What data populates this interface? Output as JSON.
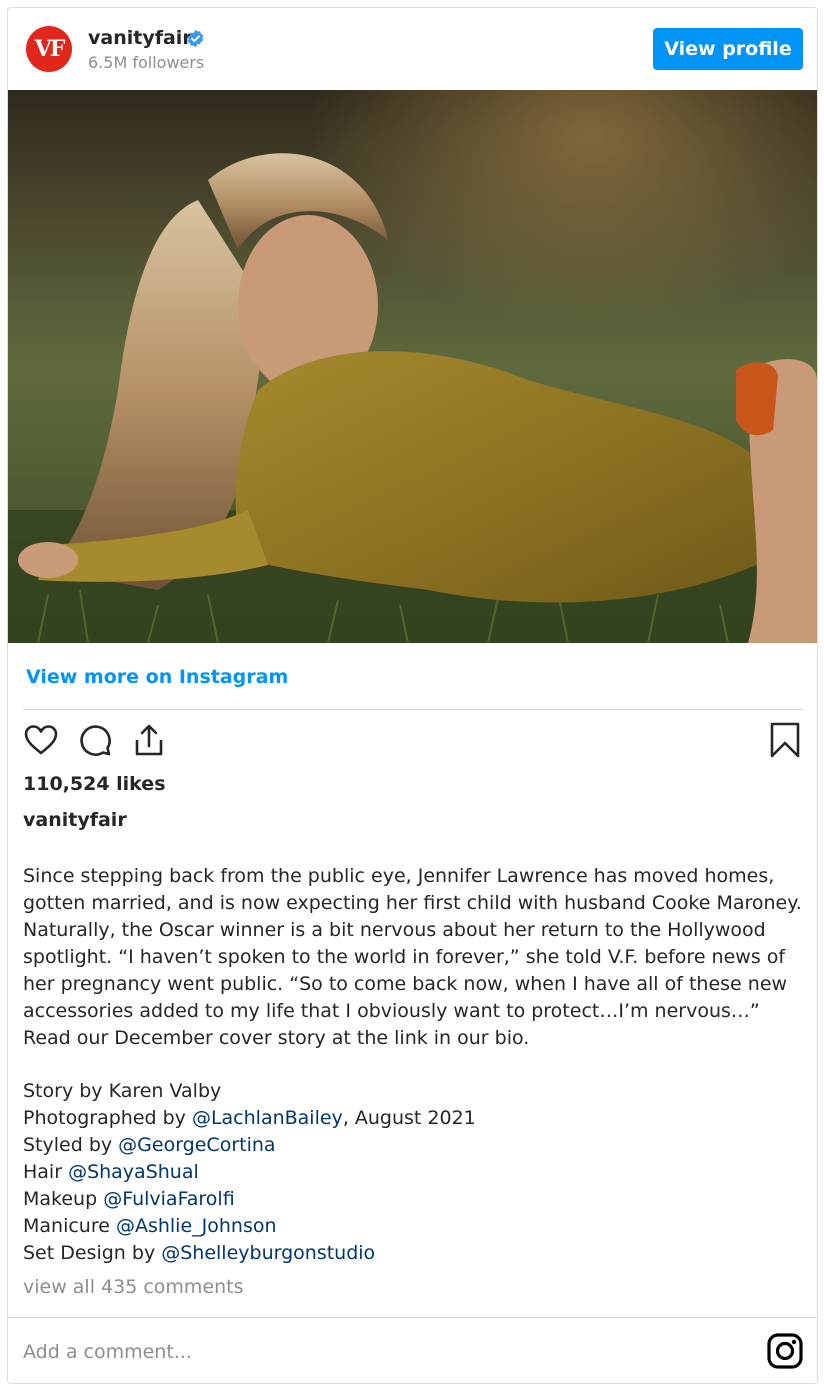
{
  "header": {
    "avatar_text": "VF",
    "username": "vanityfair",
    "verified_icon": "verified-badge-icon",
    "followers": "6.5M followers",
    "view_profile_label": "View profile"
  },
  "post": {
    "view_more_label": "View more on Instagram",
    "likes": "110,524 likes",
    "caption_username": "vanityfair",
    "caption_text": "Since stepping back from the public eye, Jennifer Lawrence has moved homes, gotten married, and is now expecting her first child with husband Cooke Maroney. Naturally, the Oscar winner is a bit nervous about her return to the Hollywood spotlight. “I haven’t spoken to the world in forever,” she told V.F. before news of her pregnancy went public. “So to come back now, when I have all of these new accessories added to my life that I obviously want to protect…I’m nervous…” Read our December cover story at the link in our bio.",
    "credits": {
      "story": "Story by Karen Valby",
      "photo_prefix": "Photographed by ",
      "photo_mention": "@LachlanBailey",
      "photo_suffix": ", August 2021",
      "styled_prefix": "Styled by ",
      "styled_mention": "@GeorgeCortina",
      "hair_prefix": "Hair ",
      "hair_mention": "@ShayaShual",
      "makeup_prefix": "Makeup ",
      "makeup_mention": "@FulviaFarolfi",
      "manicure_prefix": "Manicure ",
      "manicure_mention": "@Ashlie_Johnson",
      "set_prefix": "Set Design by ",
      "set_mention": "@Shelleyburgonstudio"
    },
    "view_comments": "view all 435 comments",
    "comment_placeholder": "Add a comment..."
  },
  "icons": {
    "like": "heart-icon",
    "comment": "comment-icon",
    "share": "share-icon",
    "save": "bookmark-icon",
    "instagram": "instagram-icon"
  },
  "colors": {
    "accent": "#0095f6",
    "mention": "#00376b",
    "muted": "#8e8e8e",
    "brand_vf": "#e1261c"
  }
}
